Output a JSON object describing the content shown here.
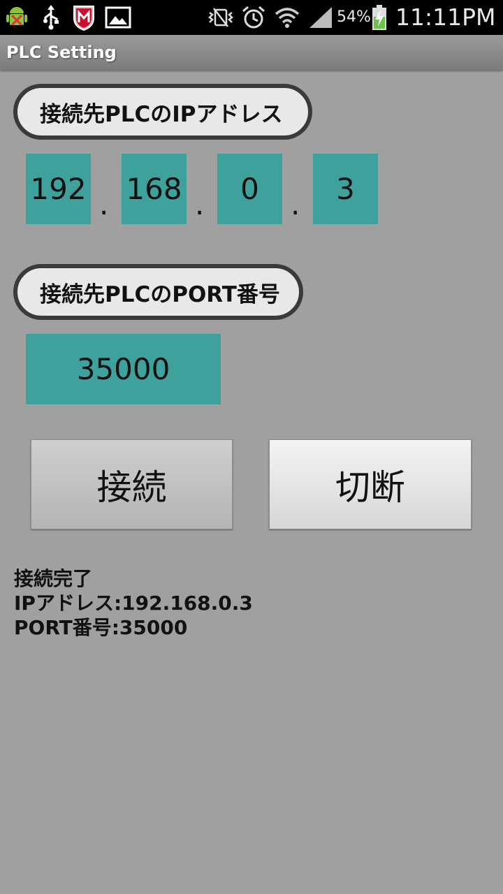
{
  "status_bar": {
    "battery_percent": "54%",
    "time": "11:11PM",
    "icons": [
      "android-debug-icon",
      "usb-icon",
      "mcafee-icon",
      "image-icon",
      "vibrate-icon",
      "alarm-icon",
      "wifi-icon",
      "signal-icon",
      "battery-charging-icon"
    ]
  },
  "title_bar": {
    "title": "PLC Setting"
  },
  "ip_section": {
    "label": "接続先PLCのIPアドレス",
    "octets": [
      "192",
      "168",
      "0",
      "3"
    ],
    "separator": "."
  },
  "port_section": {
    "label": "接続先PLCのPORT番号",
    "value": "35000"
  },
  "buttons": {
    "connect": "接続",
    "disconnect": "切断"
  },
  "status": {
    "line1": "接続完了",
    "line2": "IPアドレス:192.168.0.3",
    "line3": "PORT番号:35000"
  },
  "colors": {
    "field": "#3fa19b",
    "background": "#a0a0a0"
  }
}
